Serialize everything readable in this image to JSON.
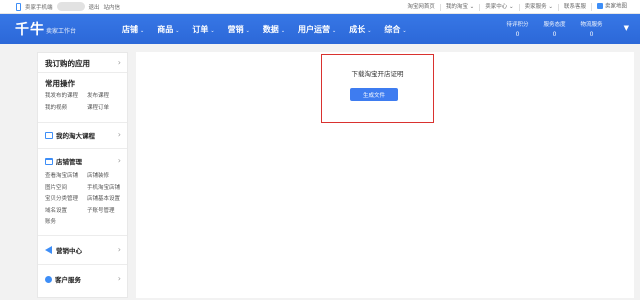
{
  "topbar": {
    "seller_phone": "卖家手机端",
    "logout": "退出",
    "site_mail": "站内信",
    "links": [
      "淘宝网首页",
      "我的淘宝 ⌄",
      "卖家中心 ⌄",
      "卖家服务 ⌄",
      "联系客服"
    ],
    "sitemap": "卖家地图"
  },
  "nav": {
    "logo": "千牛",
    "logo_sub": "卖家工作台",
    "menu": [
      "店铺",
      "商品",
      "订单",
      "营销",
      "数据",
      "用户运营",
      "成长",
      "综合"
    ],
    "caret": "⌄",
    "stats": [
      {
        "label": "待评积分",
        "value": "0"
      },
      {
        "label": "服务态度",
        "value": "0"
      },
      {
        "label": "物流服务",
        "value": "0"
      }
    ]
  },
  "sidebar": {
    "my_apps": "我订购的应用",
    "common_ops": "常用操作",
    "common_links": [
      "我发布的课程",
      "发布课程",
      "我的视频",
      "课程订单"
    ],
    "my_course": "我的淘大课程",
    "shop_mgmt": "店铺管理",
    "shop_links": [
      "查看淘宝店铺",
      "店铺装修",
      "图片空间",
      "手机淘宝店铺",
      "宝贝分类管理",
      "店铺基本设置",
      "域名设置",
      "子账号管理",
      "账务"
    ],
    "marketing": "营销中心",
    "customer": "客户服务"
  },
  "main": {
    "download_title": "下载淘宝开店证明",
    "generate_button": "生成文件"
  },
  "colors": {
    "nav_blue": "#2f6fe0",
    "button_blue": "#3e7cf0",
    "highlight_red": "#d9322f"
  }
}
